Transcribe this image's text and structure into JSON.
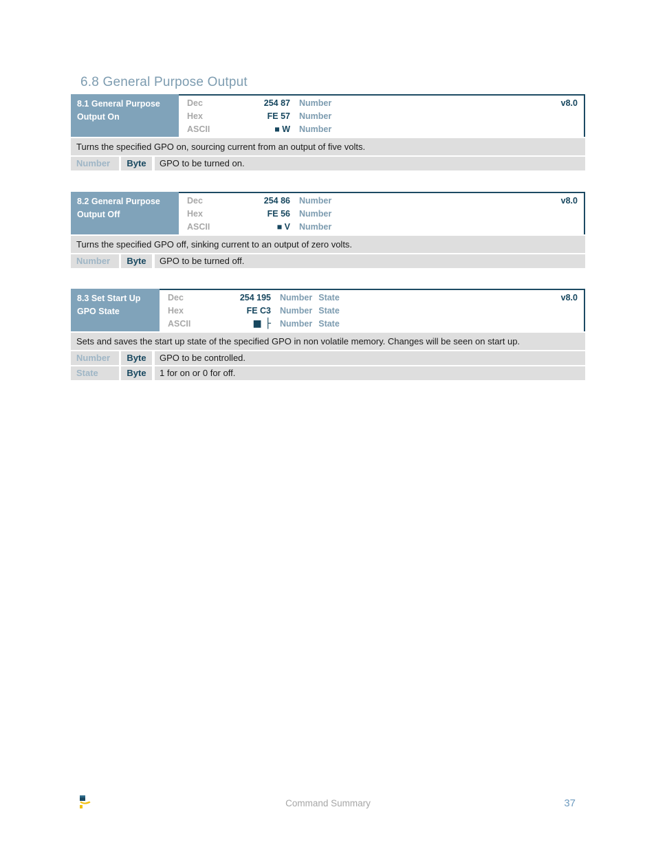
{
  "section": {
    "number": "6.8",
    "title": "6.8 General Purpose Output"
  },
  "commands": [
    {
      "id": "8.1",
      "name": "8.1 General Purpose Output On",
      "name_line1": "8.1 General Purpose",
      "name_line2": "Output On",
      "version": "v8.0",
      "label_width": "157px",
      "rows": [
        {
          "key": "Dec",
          "value": "254 87",
          "args": [
            "Number"
          ]
        },
        {
          "key": "Hex",
          "value": "FE 57",
          "args": [
            "Number"
          ]
        },
        {
          "key": "ASCII",
          "value": "■ W",
          "args": [
            "Number"
          ]
        }
      ],
      "description": "Turns the specified GPO on, sourcing current from an output of five volts.",
      "params": [
        {
          "name": "Number",
          "type": "Byte",
          "desc": "GPO to be turned on."
        }
      ]
    },
    {
      "id": "8.2",
      "name": "8.2 General Purpose Output Off",
      "name_line1": "8.2 General Purpose",
      "name_line2": "Output Off",
      "version": "v8.0",
      "label_width": "157px",
      "rows": [
        {
          "key": "Dec",
          "value": "254 86",
          "args": [
            "Number"
          ]
        },
        {
          "key": "Hex",
          "value": "FE 56",
          "args": [
            "Number"
          ]
        },
        {
          "key": "ASCII",
          "value": "■ V",
          "args": [
            "Number"
          ]
        }
      ],
      "description": "Turns the specified GPO off, sinking current to an output of zero volts.",
      "params": [
        {
          "name": "Number",
          "type": "Byte",
          "desc": "GPO to be turned off."
        }
      ]
    },
    {
      "id": "8.3",
      "name": "8.3 Set Start Up GPO State",
      "name_line1": "8.3 Set Start Up",
      "name_line2": "GPO State",
      "version": "v8.0",
      "label_width": "129px",
      "rows": [
        {
          "key": "Dec",
          "value": "254 195",
          "args": [
            "Number",
            "State"
          ]
        },
        {
          "key": "Hex",
          "value": "FE C3",
          "args": [
            "Number",
            "State"
          ]
        },
        {
          "key": "ASCII",
          "value": "■ ├",
          "args": [
            "Number",
            "State"
          ]
        }
      ],
      "description": "Sets and saves the start up state of the specified GPO in non volatile memory.  Changes will be seen on start up.",
      "params": [
        {
          "name": "Number",
          "type": "Byte",
          "desc": "GPO to be controlled."
        },
        {
          "name": "State",
          "type": "Byte",
          "desc": "1 for on or 0 for off."
        }
      ]
    }
  ],
  "footer": {
    "center_text": "Command Summary",
    "page_number": "37",
    "logo_name": "matrix-orbital-logo"
  },
  "colors": {
    "heading": "#7d9cb0",
    "label_bg": "#80a3ba",
    "border": "#1c4a63",
    "value": "#17475f",
    "arg": "#7d9cb0",
    "key": "#a8a8a8",
    "row_bg": "#dedede",
    "param_name": "#9fb6c6",
    "page_number": "#6f9cc0",
    "footer_text": "#a6a6a6"
  },
  "block_tops": [
    "137px",
    "279px",
    "420px"
  ]
}
